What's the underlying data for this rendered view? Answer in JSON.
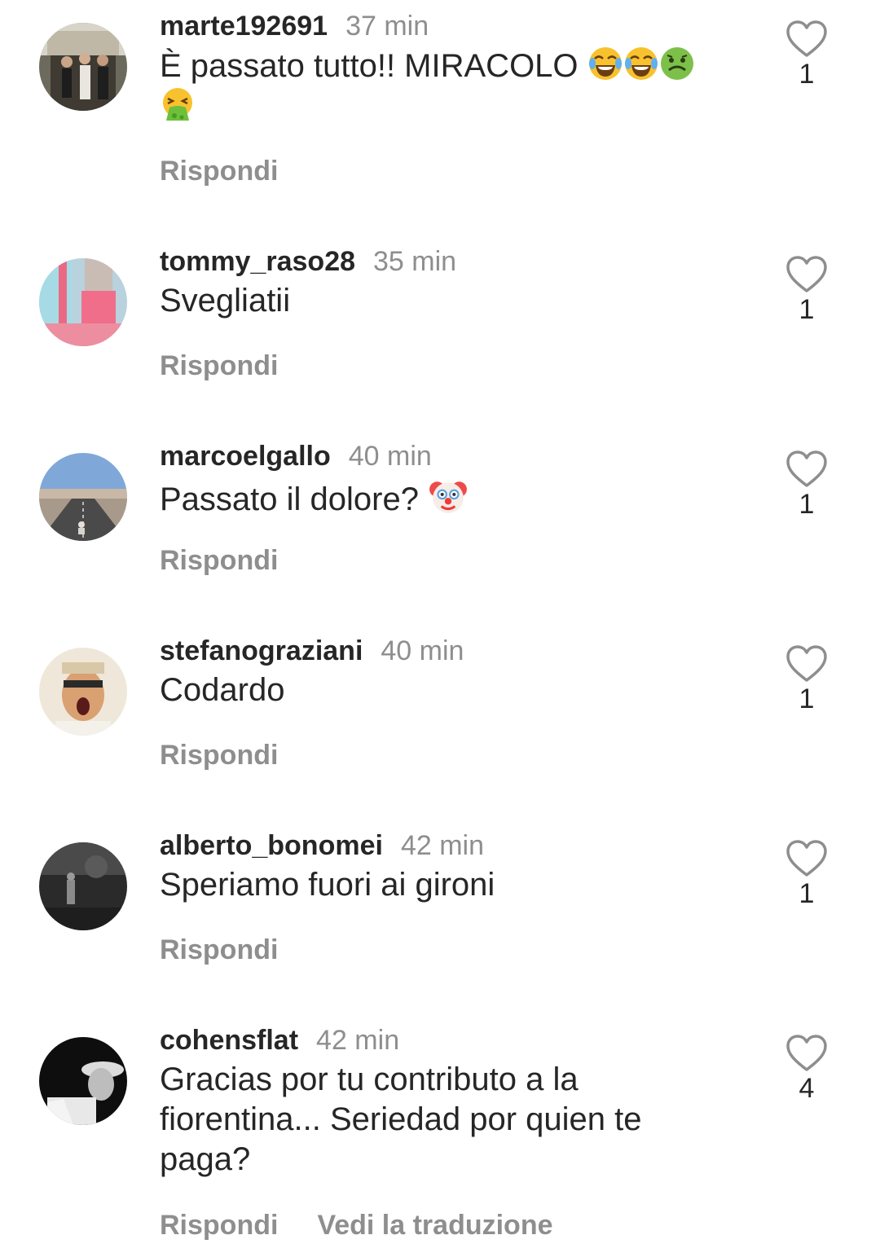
{
  "comments": [
    {
      "username": "marte192691",
      "time": "37 min",
      "text": "È passato tutto!! MIRACOLO",
      "emojis": [
        "face-with-tears-of-joy-icon",
        "face-with-tears-of-joy-icon",
        "nauseated-face-icon",
        "face-vomiting-icon"
      ],
      "likes": "1",
      "reply": "Rispondi"
    },
    {
      "username": "tommy_raso28",
      "time": "35 min",
      "text": "Svegliatii",
      "likes": "1",
      "reply": "Rispondi"
    },
    {
      "username": "marcoelgallo",
      "time": "40 min",
      "text": "Passato il dolore?",
      "emojis": [
        "clown-face-icon"
      ],
      "likes": "1",
      "reply": "Rispondi"
    },
    {
      "username": "stefanograziani",
      "time": "40 min",
      "text": "Codardo",
      "likes": "1",
      "reply": "Rispondi"
    },
    {
      "username": "alberto_bonomei",
      "time": "42 min",
      "text": "Speriamo fuori ai gironi",
      "likes": "1",
      "reply": "Rispondi"
    },
    {
      "username": "cohensflat",
      "time": "42 min",
      "text": "Gracias por tu contributo a la fiorentina... Seriedad por quien te paga?",
      "likes": "4",
      "reply": "Rispondi",
      "translate": "Vedi la traduzione"
    }
  ],
  "colors": {
    "text_primary": "#262626",
    "text_secondary": "#8e8e8e",
    "background": "#ffffff"
  }
}
